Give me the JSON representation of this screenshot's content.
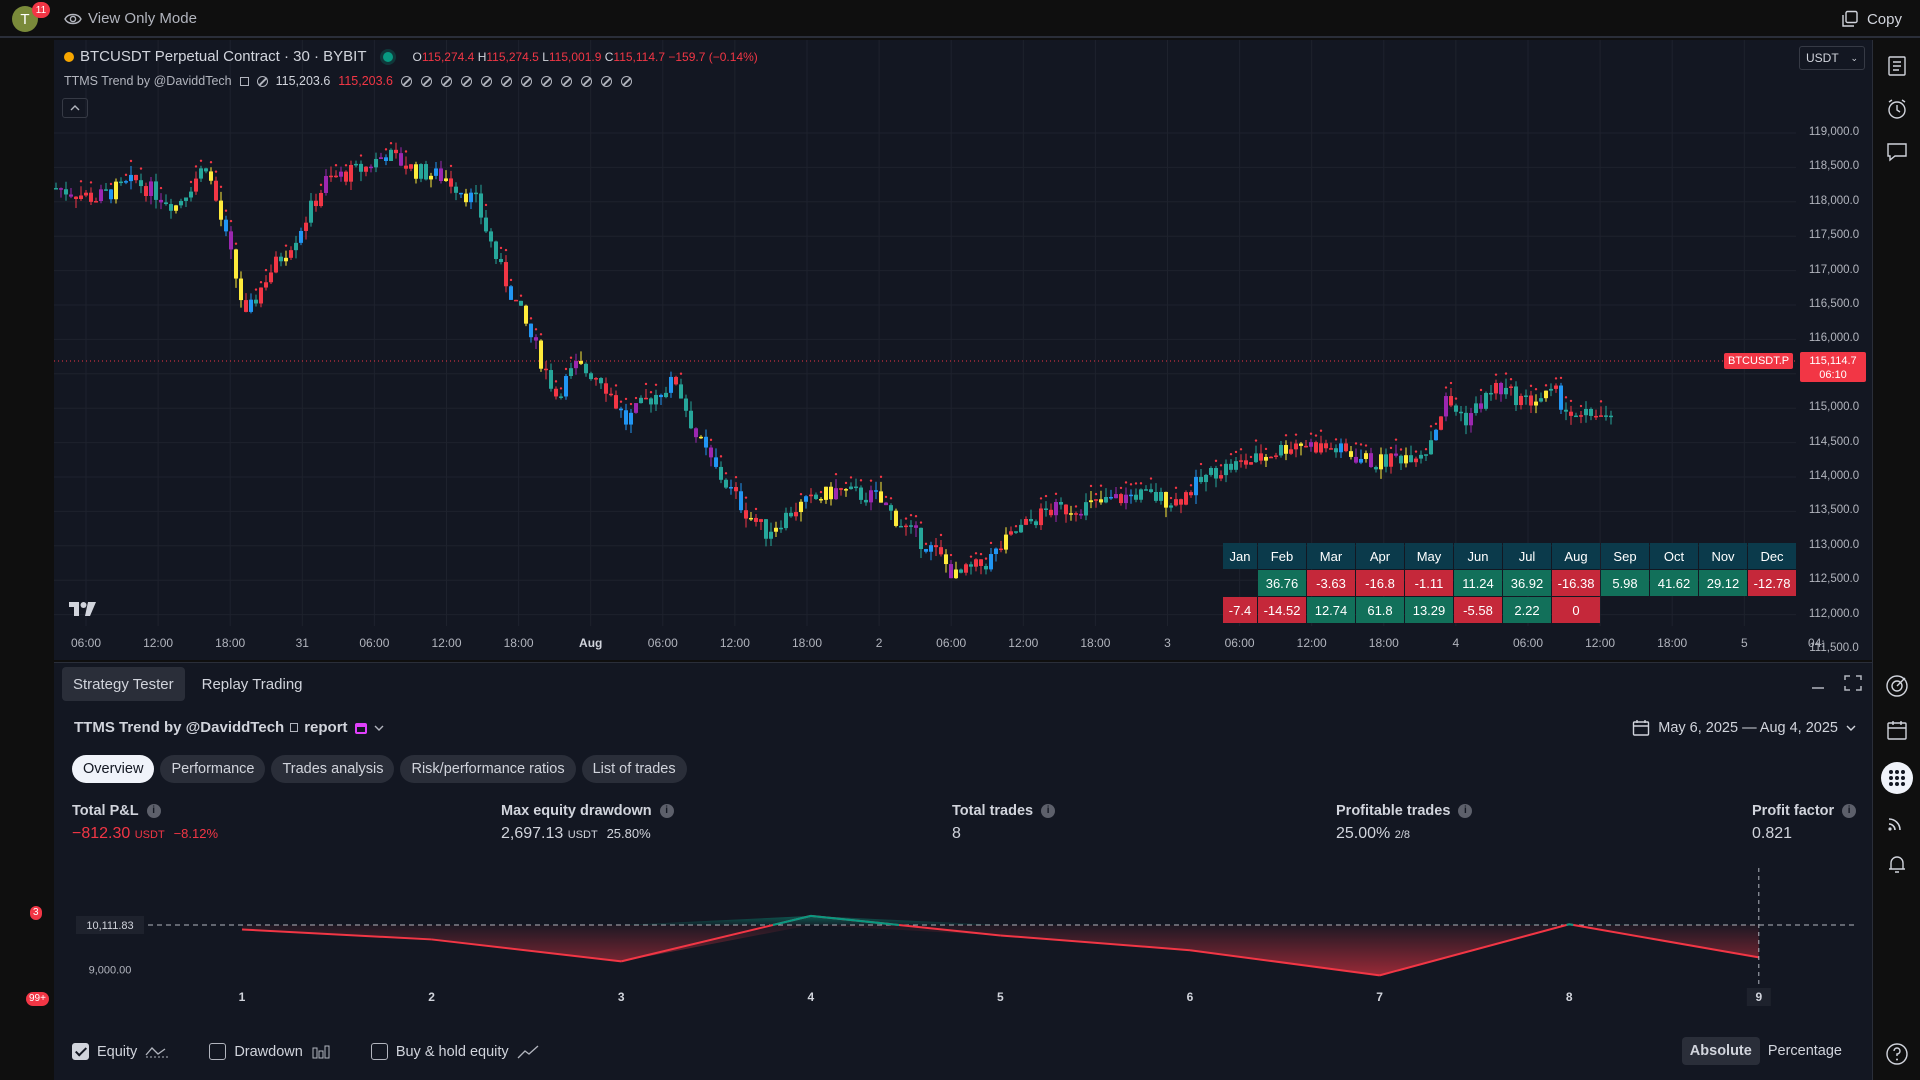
{
  "topbar": {
    "avatar_letter": "T",
    "avatar_badge": "11",
    "view_mode": "View Only Mode",
    "copy": "Copy"
  },
  "chart": {
    "symbol_title": "BTCUSDT Perpetual Contract · 30 · BYBIT",
    "ohlc": {
      "o_label": "O",
      "o": "115,274.4",
      "h_label": "H",
      "h": "115,274.5",
      "l_label": "L",
      "l": "115,001.9",
      "c_label": "C",
      "c": "115,114.7",
      "change": "−159.7 (−0.14%)"
    },
    "indicator": {
      "name": "TTMS Trend by @DaviddTech",
      "v1": "115,203.6",
      "v2": "115,203.6"
    },
    "currency": "USDT",
    "current_price": "115,114.7",
    "countdown": "06:10",
    "symbol_label": "BTCUSDT.P",
    "price_ticks": [
      "119,000.0",
      "118,500.0",
      "118,000.0",
      "117,500.0",
      "117,000.0",
      "116,500.0",
      "116,000.0",
      "115,500.0",
      "115,000.0",
      "114,500.0",
      "114,000.0",
      "113,500.0",
      "113,000.0",
      "112,500.0",
      "112,000.0",
      "111,500.0"
    ],
    "time_ticks": [
      {
        "label": "06:00",
        "bold": false
      },
      {
        "label": "12:00",
        "bold": false
      },
      {
        "label": "18:00",
        "bold": false
      },
      {
        "label": "31",
        "bold": false
      },
      {
        "label": "06:00",
        "bold": false
      },
      {
        "label": "12:00",
        "bold": false
      },
      {
        "label": "18:00",
        "bold": false
      },
      {
        "label": "Aug",
        "bold": true
      },
      {
        "label": "06:00",
        "bold": false
      },
      {
        "label": "12:00",
        "bold": false
      },
      {
        "label": "18:00",
        "bold": false
      },
      {
        "label": "2",
        "bold": false
      },
      {
        "label": "06:00",
        "bold": false
      },
      {
        "label": "12:00",
        "bold": false
      },
      {
        "label": "18:00",
        "bold": false
      },
      {
        "label": "3",
        "bold": false
      },
      {
        "label": "06:00",
        "bold": false
      },
      {
        "label": "12:00",
        "bold": false
      },
      {
        "label": "18:00",
        "bold": false
      },
      {
        "label": "4",
        "bold": false
      },
      {
        "label": "06:00",
        "bold": false
      },
      {
        "label": "12:00",
        "bold": false
      },
      {
        "label": "18:00",
        "bold": false
      },
      {
        "label": "5",
        "bold": false
      },
      {
        "label": "04:",
        "bold": false
      }
    ],
    "monthly_table": {
      "headers": [
        "Jan",
        "Feb",
        "Mar",
        "Apr",
        "May",
        "Jun",
        "Jul",
        "Aug",
        "Sep",
        "Oct",
        "Nov",
        "Dec"
      ],
      "rows": [
        [
          "",
          "36.76",
          "-3.63",
          "-16.8",
          "-1.11",
          "11.24",
          "36.92",
          "-16.38",
          "5.98",
          "41.62",
          "29.12",
          "-12.78"
        ],
        [
          "-7.4",
          "-14.52",
          "12.74",
          "61.8",
          "13.29",
          "-5.58",
          "2.22",
          "0",
          "",
          "",
          "",
          ""
        ]
      ]
    },
    "colors": {
      "up": "#26a69a",
      "down": "#f23645",
      "yellow": "#ffeb3b",
      "purple": "#9c27b0",
      "blue": "#2196f3"
    }
  },
  "panel": {
    "tabs": [
      "Strategy Tester",
      "Replay Trading"
    ],
    "report_title": "TTMS Trend by @DaviddTech",
    "report_suffix": "report",
    "date_range": "May 6, 2025 — Aug 4, 2025",
    "subtabs": [
      "Overview",
      "Performance",
      "Trades analysis",
      "Risk/performance ratios",
      "List of trades"
    ],
    "metrics": [
      {
        "label": "Total P&L",
        "value": "−812.30",
        "unit": "USDT",
        "extra": "−8.12%",
        "negative": true
      },
      {
        "label": "Max equity drawdown",
        "value": "2,697.13",
        "unit": "USDT",
        "extra": "25.80%",
        "negative": false
      },
      {
        "label": "Total trades",
        "value": "8",
        "unit": "",
        "extra": "",
        "negative": false
      },
      {
        "label": "Profitable trades",
        "value": "25.00%",
        "unit": "",
        "extra": "2/8",
        "negative": false
      },
      {
        "label": "Profit factor",
        "value": "0.821",
        "unit": "",
        "extra": "",
        "negative": false
      }
    ],
    "equity_chart": {
      "baseline_label": "10,111.83",
      "tick_label": "9,000.00",
      "x_labels": [
        "1",
        "2",
        "3",
        "4",
        "5",
        "6",
        "7",
        "8",
        "9"
      ],
      "baseline": 10111.83,
      "equity": [
        10000,
        9750,
        9200,
        10340,
        9850,
        9480,
        8850,
        10130,
        9300
      ]
    },
    "legend": {
      "equity": "Equity",
      "drawdown": "Drawdown",
      "buyhold": "Buy & hold equity"
    },
    "toggle": [
      "Absolute",
      "Percentage"
    ]
  },
  "sidebar_badges": {
    "feed": "3",
    "notifications": "99+"
  }
}
